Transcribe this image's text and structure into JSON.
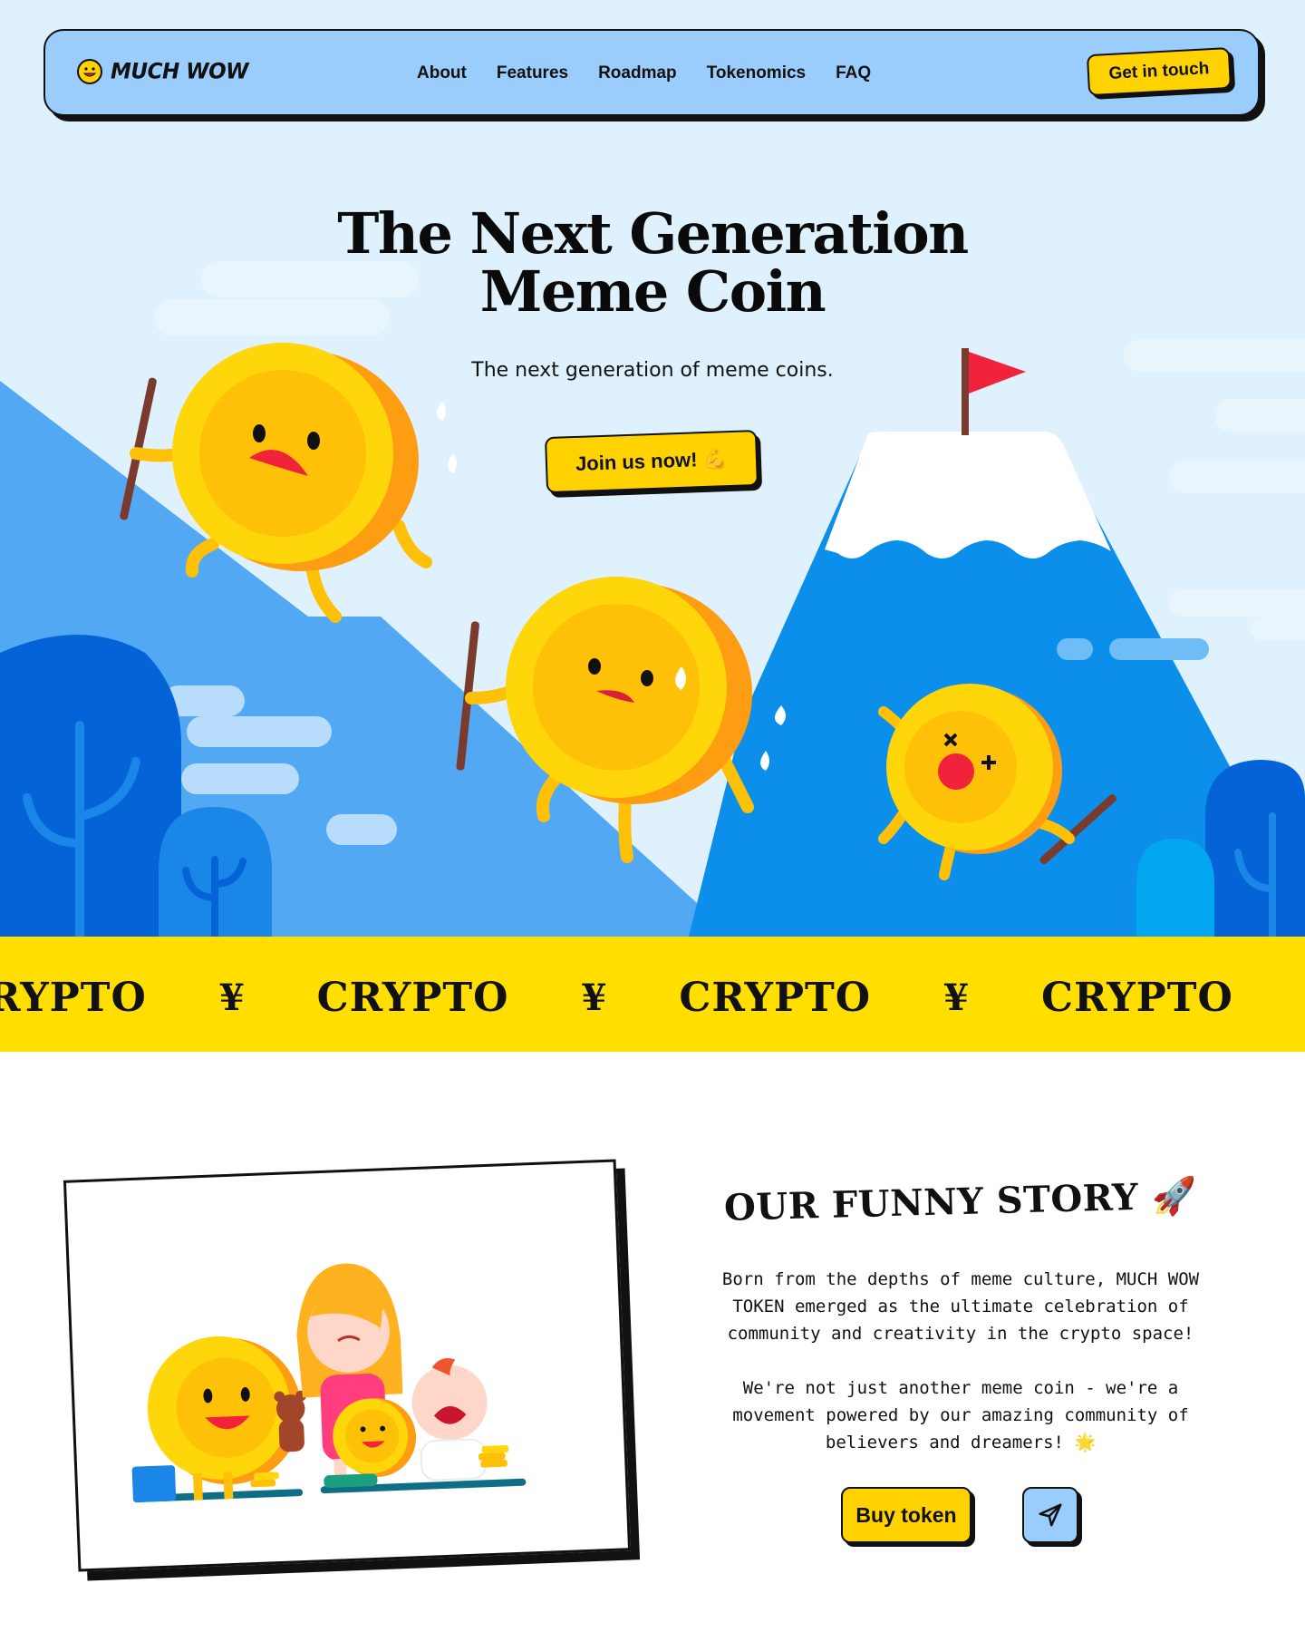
{
  "brand": {
    "name": "MUCH WOW"
  },
  "nav": {
    "items": [
      "About",
      "Features",
      "Roadmap",
      "Tokenomics",
      "FAQ"
    ],
    "cta": "Get in touch"
  },
  "hero": {
    "title_line1": "The Next Generation",
    "title_line2": "Meme Coin",
    "subtitle": "The next generation of meme coins.",
    "button": "Join us now!",
    "button_emoji": "💪"
  },
  "ticker": {
    "word": "CRYPTO",
    "symbol": "¥"
  },
  "story": {
    "title": "OUR FUNNY STORY",
    "title_emoji": "🚀",
    "paragraph1": "Born from the depths of meme culture, MUCH WOW TOKEN emerged as the ultimate celebration of community and creativity in the crypto space!",
    "paragraph2": "We're not just another meme coin - we're a movement powered by our amazing community of believers and dreamers!",
    "paragraph2_emoji": "🌟",
    "buy_button": "Buy token"
  },
  "colors": {
    "nav_bg": "#9acdfb",
    "accent_yellow": "#ffd200",
    "ticker_bg": "#ffde00",
    "sky": "#dff1fc",
    "mountain_blue": "#0b8fea",
    "flag_red": "#f0233a"
  },
  "icons": {
    "send": "paper-plane-icon",
    "logo": "smiley-coin-icon"
  }
}
